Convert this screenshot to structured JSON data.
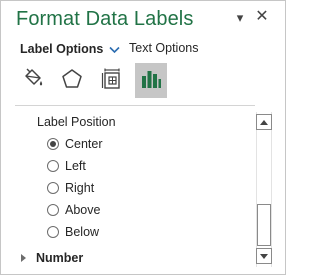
{
  "pane": {
    "title": "Format Data Labels",
    "dropdown_glyph": "▾",
    "close_glyph": "✕"
  },
  "options": {
    "label_options": "Label Options",
    "text_options": "Text Options"
  },
  "tabs": [
    {
      "name": "fill-line",
      "icon": "paint-bucket-icon",
      "selected": false
    },
    {
      "name": "effects",
      "icon": "pentagon-icon",
      "selected": false
    },
    {
      "name": "size-properties",
      "icon": "size-properties-icon",
      "selected": false
    },
    {
      "name": "label-options",
      "icon": "bar-chart-icon",
      "selected": true
    }
  ],
  "label_position": {
    "heading": "Label Position",
    "options": [
      {
        "label": "Center",
        "checked": true
      },
      {
        "label": "Left",
        "checked": false
      },
      {
        "label": "Right",
        "checked": false
      },
      {
        "label": "Above",
        "checked": false
      },
      {
        "label": "Below",
        "checked": false
      }
    ]
  },
  "sections": {
    "number": "Number"
  },
  "colors": {
    "title": "#217346",
    "selected_tab": "#c6c6c6",
    "chart_icon": "#217346"
  }
}
